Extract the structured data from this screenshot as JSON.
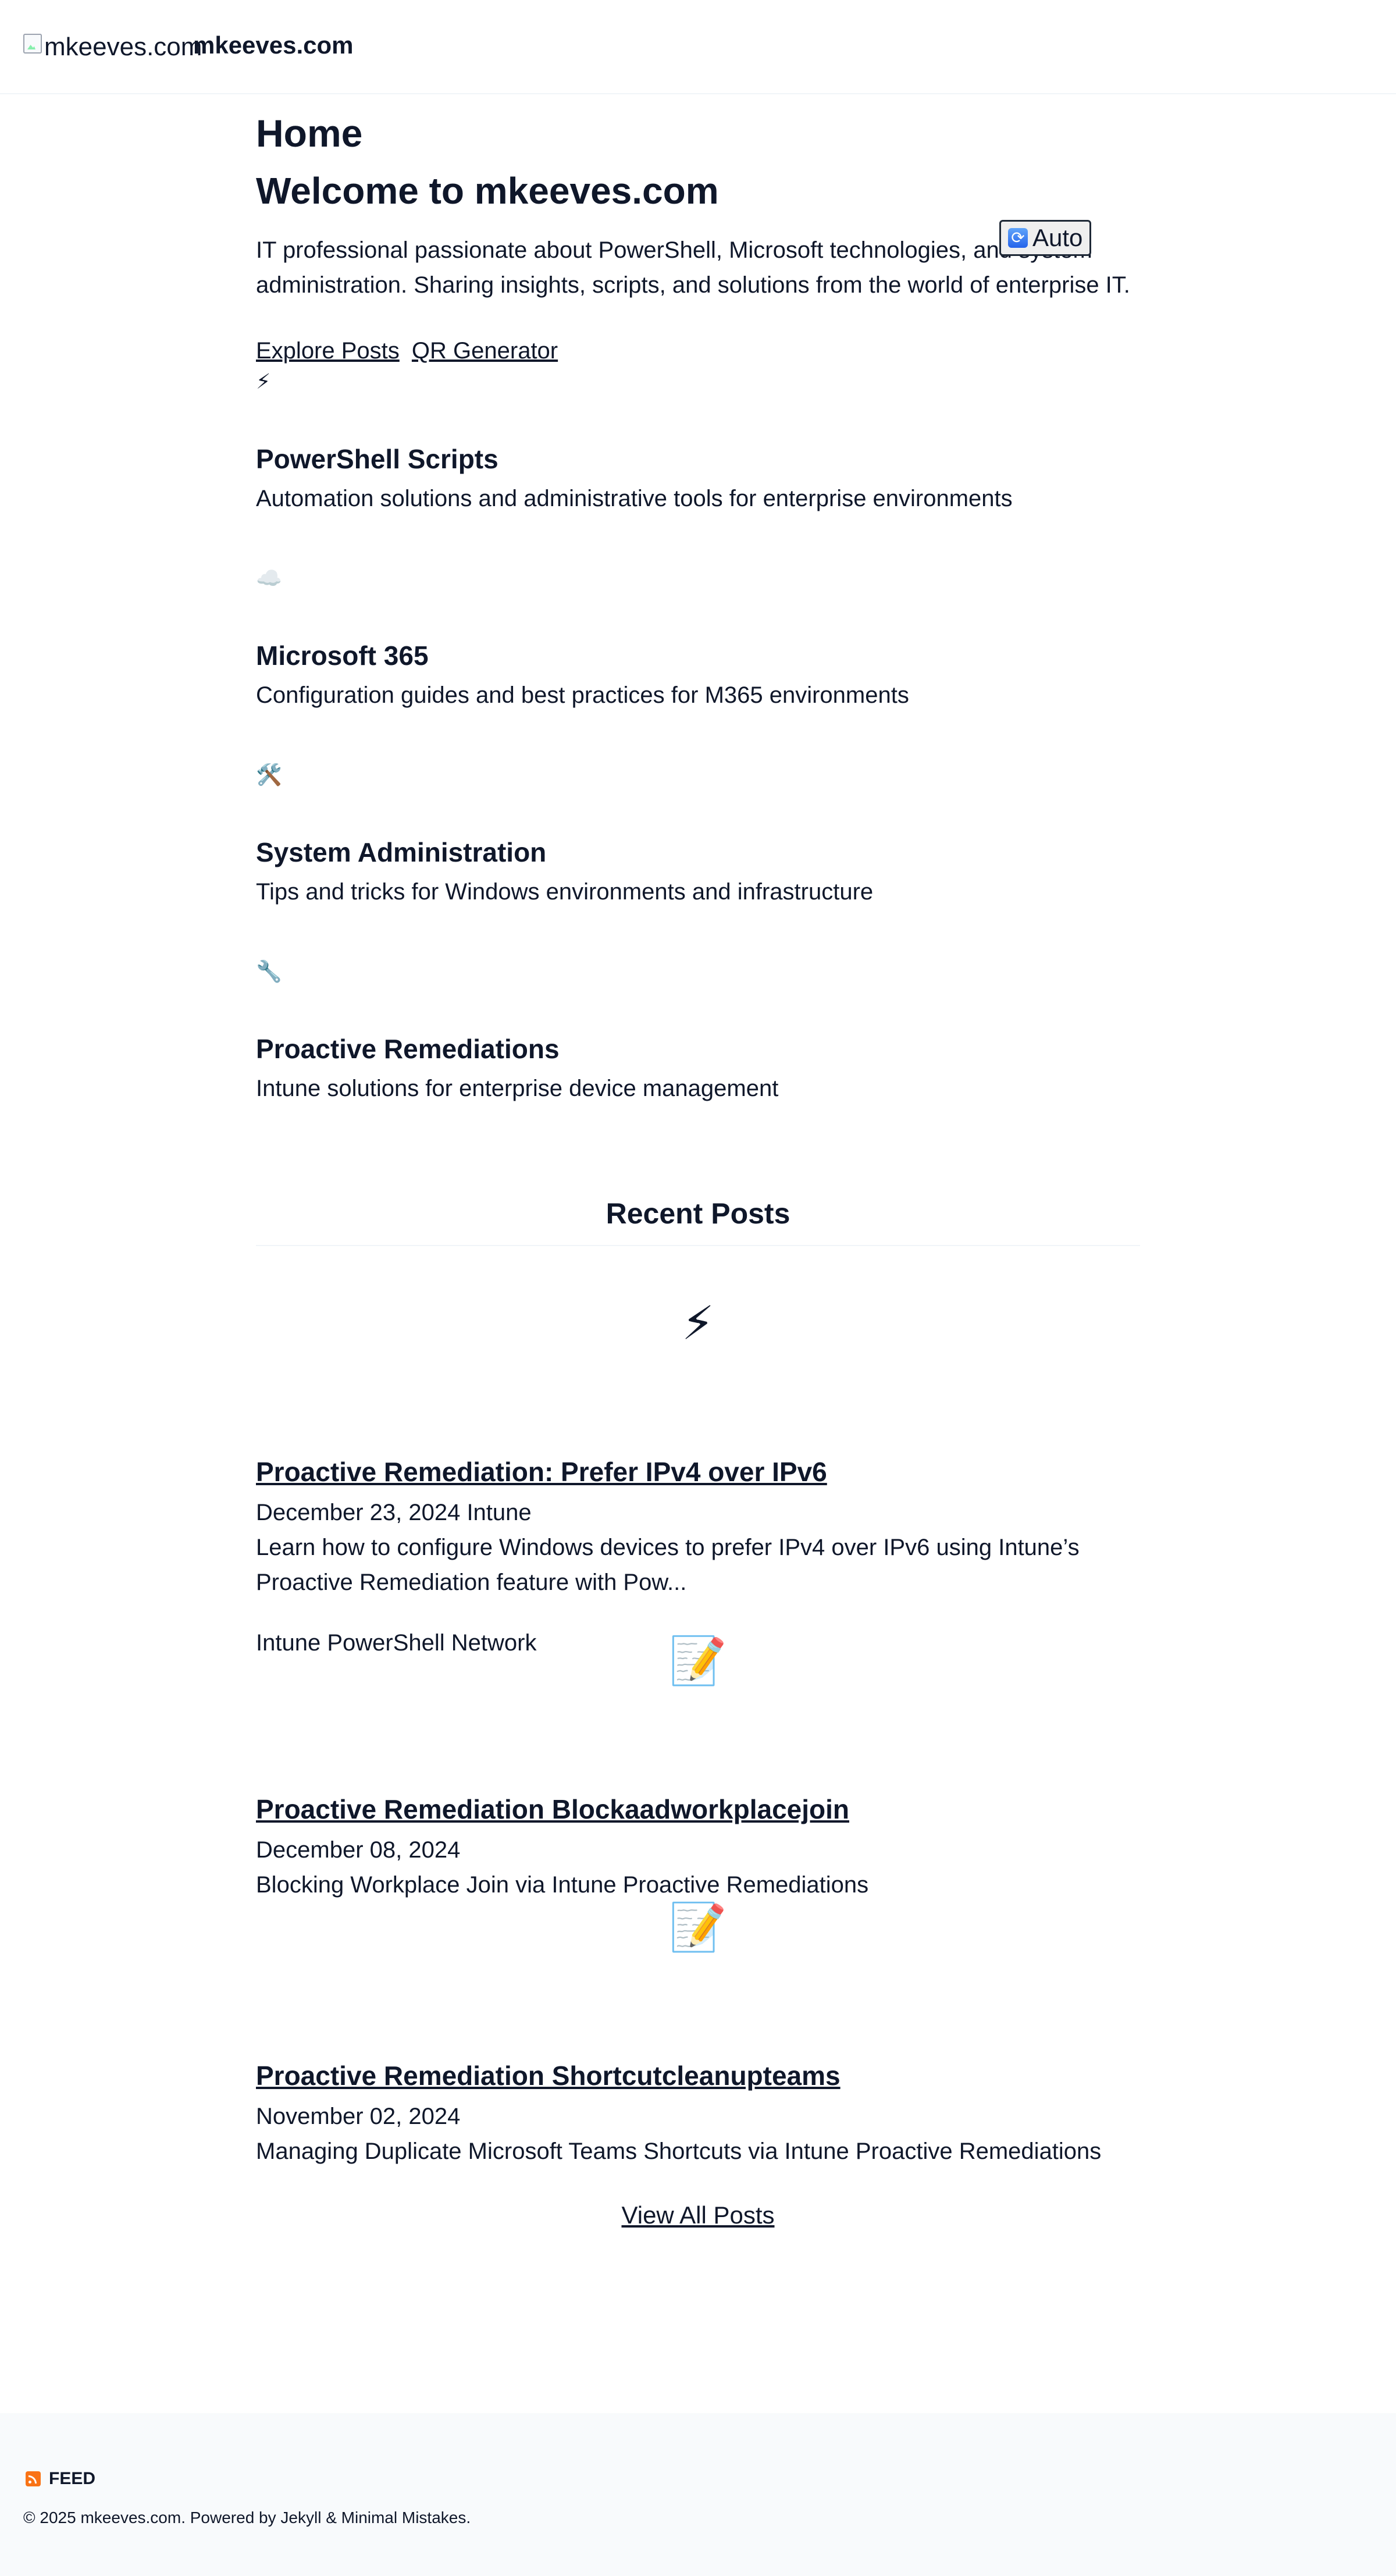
{
  "header": {
    "logo_alt": "mkeeves.com",
    "site_title": "mkeeves.com"
  },
  "page": {
    "title": "Home",
    "welcome": "Welcome to mkeeves.com",
    "intro": "IT professional passionate about PowerShell, Microsoft technologies, and system administration. Sharing insights, scripts, and solutions from the world of enterprise IT.",
    "links": [
      {
        "label": "Explore Posts"
      },
      {
        "label": "QR Generator"
      }
    ]
  },
  "theme_toggle": {
    "icon": "🔄",
    "label": "Auto"
  },
  "features": [
    {
      "icon": "⚡",
      "title": "PowerShell Scripts",
      "description": "Automation solutions and administrative tools for enterprise environments"
    },
    {
      "icon": "☁️",
      "title": "Microsoft 365",
      "description": "Configuration guides and best practices for M365 environments"
    },
    {
      "icon": "🛠️",
      "title": "System Administration",
      "description": "Tips and tricks for Windows environments and infrastructure"
    },
    {
      "icon": "🔧",
      "title": "Proactive Remediations",
      "description": "Intune solutions for enterprise device management"
    }
  ],
  "recent_posts": {
    "heading": "Recent Posts",
    "posts": [
      {
        "thumb": "⚡",
        "title": "Proactive Remediation: Prefer IPv4 over IPv6",
        "meta": "December 23, 2024 Intune",
        "excerpt": "Learn how to configure Windows devices to prefer IPv4 over IPv6 using Intune’s Proactive Remediation feature with Pow...",
        "tags": "Intune PowerShell Network"
      },
      {
        "thumb": "📝",
        "title": "Proactive Remediation Blockaadworkplacejoin",
        "meta": "December 08, 2024",
        "excerpt": "Blocking Workplace Join via Intune Proactive Remediations"
      },
      {
        "thumb": "📝",
        "title": "Proactive Remediation Shortcutcleanupteams",
        "meta": "November 02, 2024",
        "excerpt": "Managing Duplicate Microsoft Teams Shortcuts via Intune Proactive Remediations"
      }
    ],
    "view_all": "View All Posts"
  },
  "footer": {
    "feed_label": "FEED",
    "copyright": "© 2025 mkeeves.com. Powered by Jekyll & Minimal Mistakes."
  }
}
